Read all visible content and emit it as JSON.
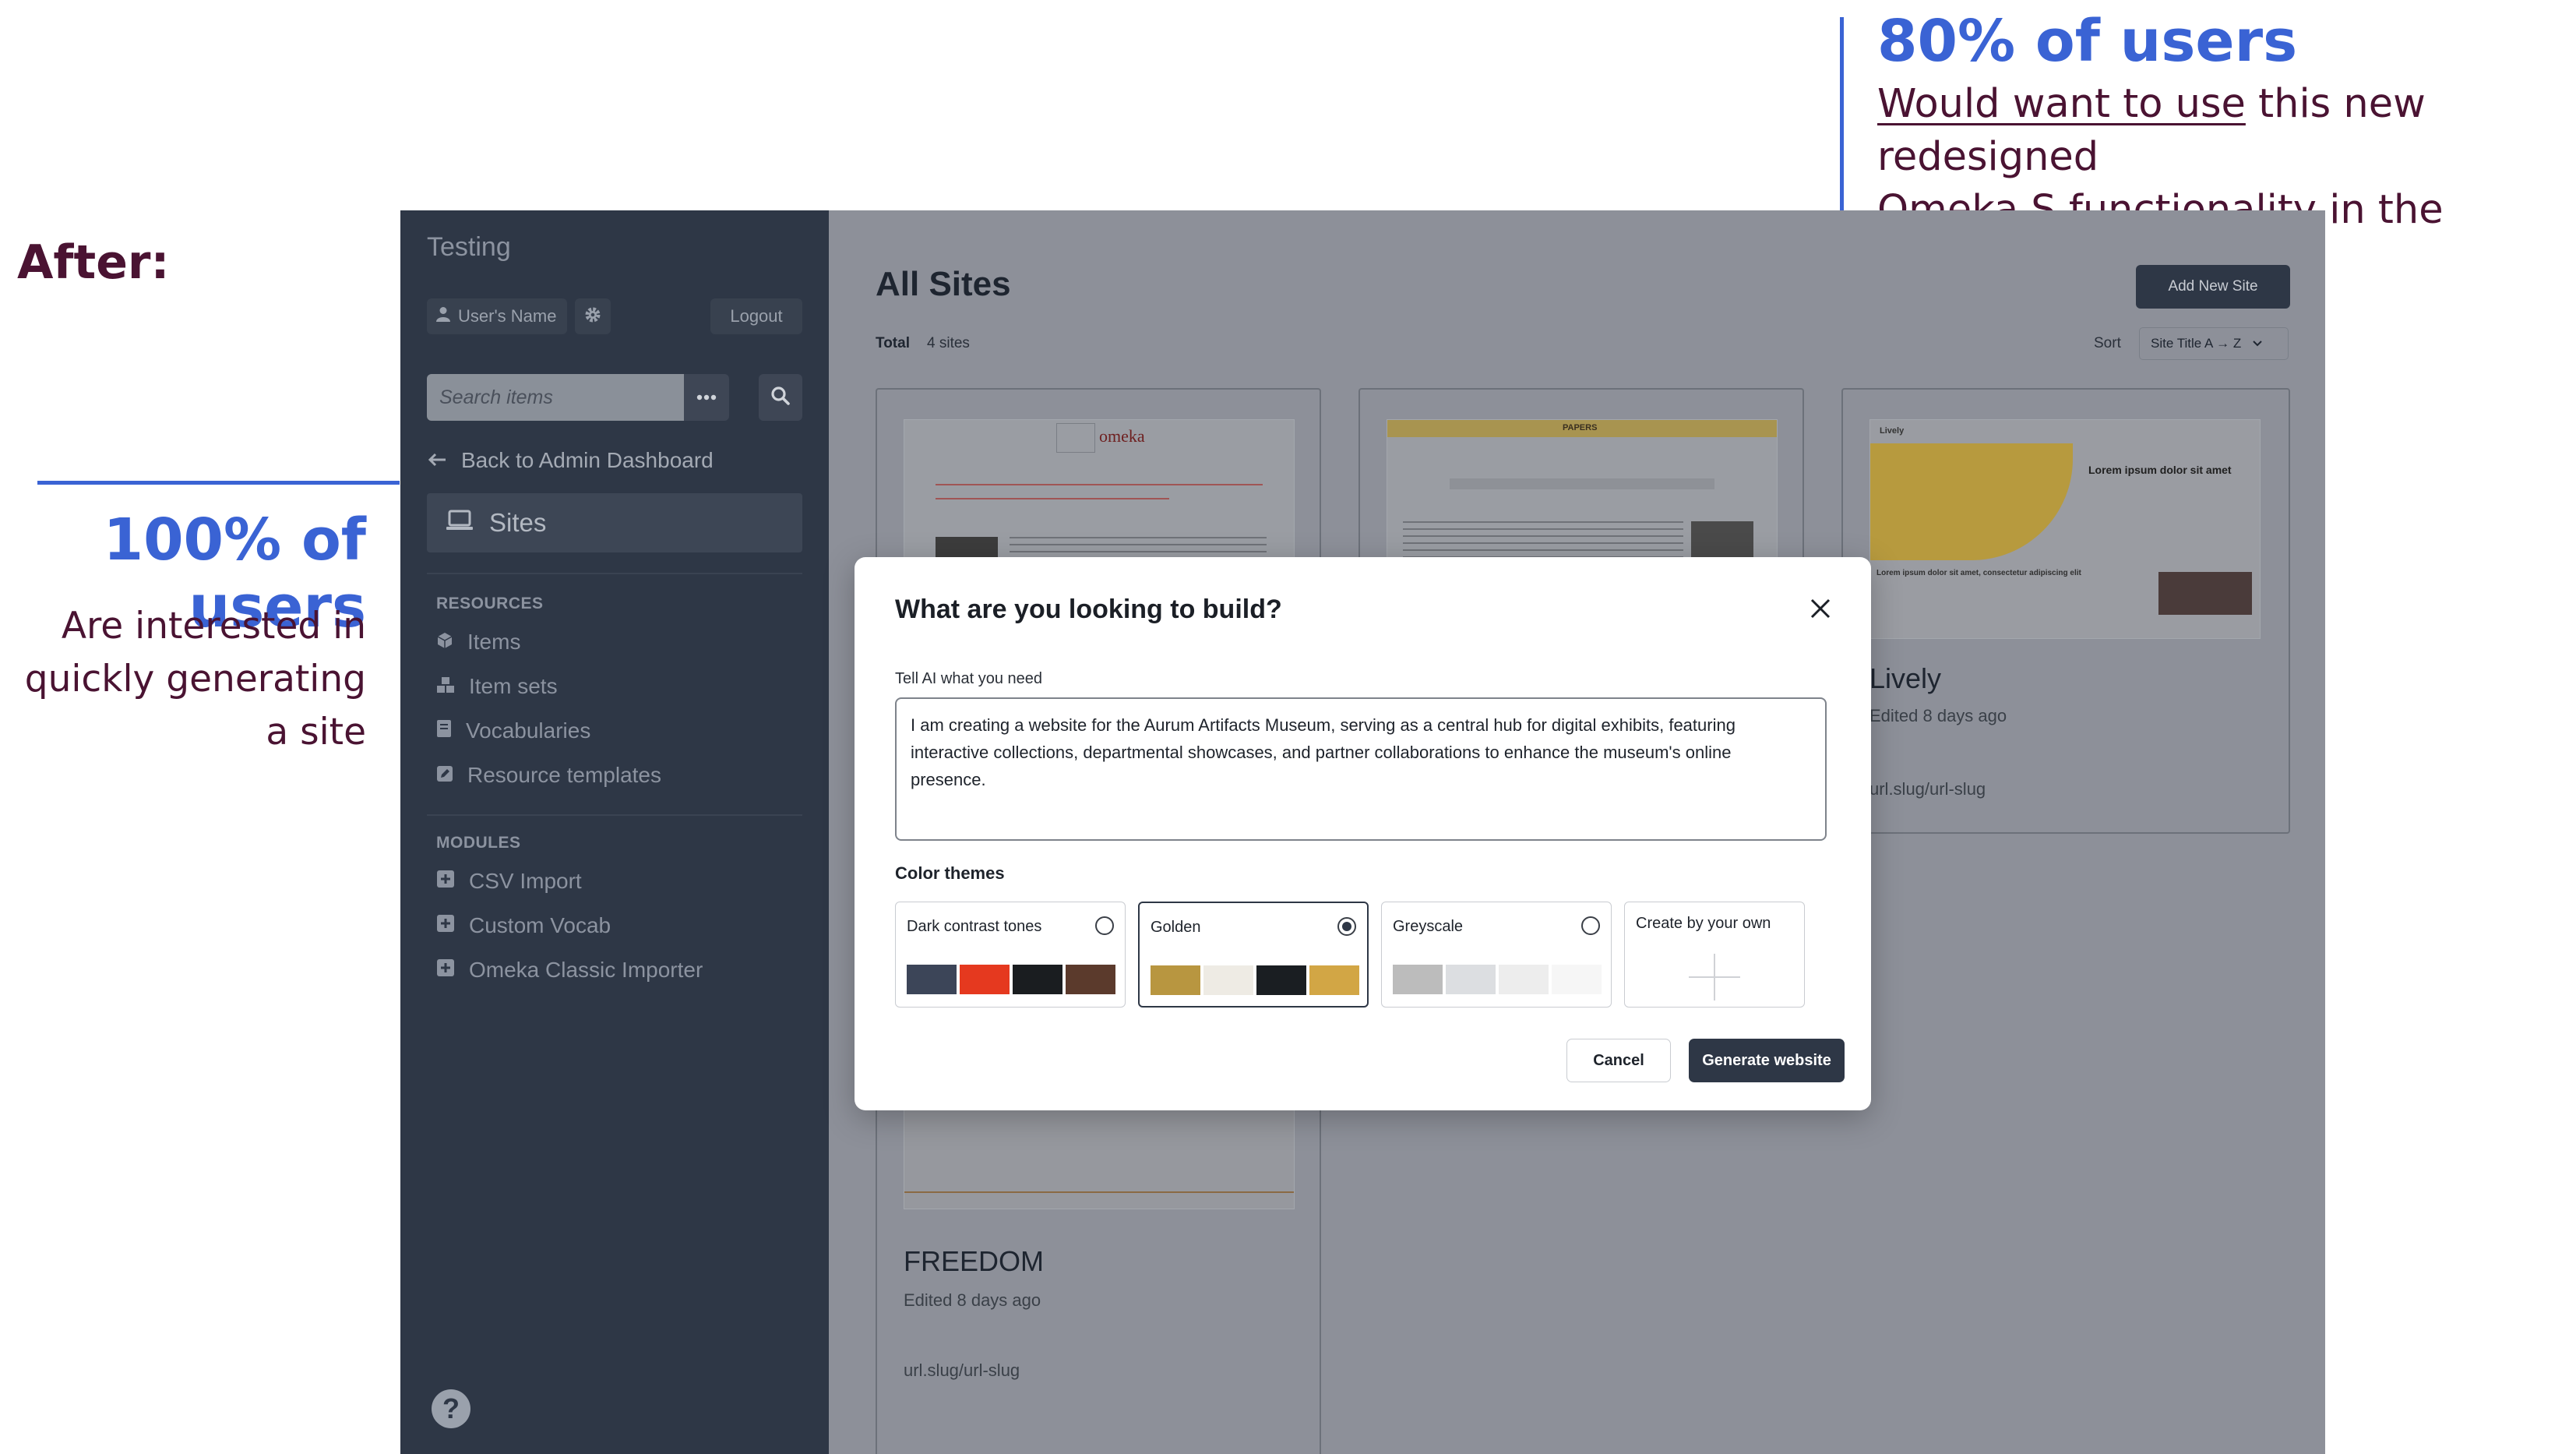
{
  "annotations": {
    "after_label": "After:",
    "left_stat": {
      "percent": "100% of users",
      "line1": "Are interested in",
      "line2": "quickly generating",
      "line3": "a site"
    },
    "right_stat": {
      "percent": "80% of users",
      "underlined": "Would want to use",
      "rest_line1": " this new redesigned",
      "line2": "Omeka S functionality in the future!"
    }
  },
  "sidebar": {
    "title": "Testing",
    "user_name": "User's Name",
    "logout": "Logout",
    "search_placeholder": "Search items",
    "back_link": "Back to Admin Dashboard",
    "active_item": "Sites",
    "resources_heading": "RESOURCES",
    "resources": [
      "Items",
      "Item sets",
      "Vocabularies",
      "Resource templates"
    ],
    "modules_heading": "MODULES",
    "modules": [
      "CSV Import",
      "Custom Vocab",
      "Omeka Classic Importer"
    ],
    "help": "?"
  },
  "main": {
    "title": "All Sites",
    "total_label": "Total",
    "total_value": "4 sites",
    "add_button": "Add New Site",
    "sort_label": "Sort",
    "sort_value": "Site Title  A → Z",
    "cards": [
      {
        "name": "omeka",
        "thumb_brand": "omeka"
      },
      {
        "name": "PAPERS",
        "thumb_brand": "PAPERS"
      },
      {
        "name": "Lively",
        "edited": "Edited 8 days ago",
        "url": "url.slug/url-slug",
        "thumb_brand": "Lively",
        "thumb_heading": "Lorem ipsum dolor sit amet",
        "thumb_sub": "Lorem ipsum dolor sit amet, consectetur adipiscing elit"
      },
      {
        "name": "FREEDOM",
        "edited": "Edited 8 days ago",
        "url": "url.slug/url-slug"
      }
    ]
  },
  "modal": {
    "title": "What are you looking to build?",
    "input_label": "Tell AI what you need",
    "input_value": "I am creating a website for the Aurum Artifacts Museum, serving as a central hub for digital exhibits, featuring interactive collections, departmental showcases, and partner collaborations to enhance the museum's online presence.",
    "themes_label": "Color themes",
    "themes": [
      {
        "name": "Dark contrast tones",
        "selected": false,
        "colors": [
          "#3c4558",
          "#e5391f",
          "#1a1d20",
          "#5b3a2c"
        ]
      },
      {
        "name": "Golden",
        "selected": true,
        "colors": [
          "#b89640",
          "#eeebe4",
          "#1a1e22",
          "#d2a645"
        ]
      },
      {
        "name": "Greyscale",
        "selected": false,
        "colors": [
          "#bcbcbc",
          "#dcdee1",
          "#ededed",
          "#f6f6f6"
        ]
      }
    ],
    "create_own": "Create by your own",
    "cancel": "Cancel",
    "generate": "Generate website"
  }
}
